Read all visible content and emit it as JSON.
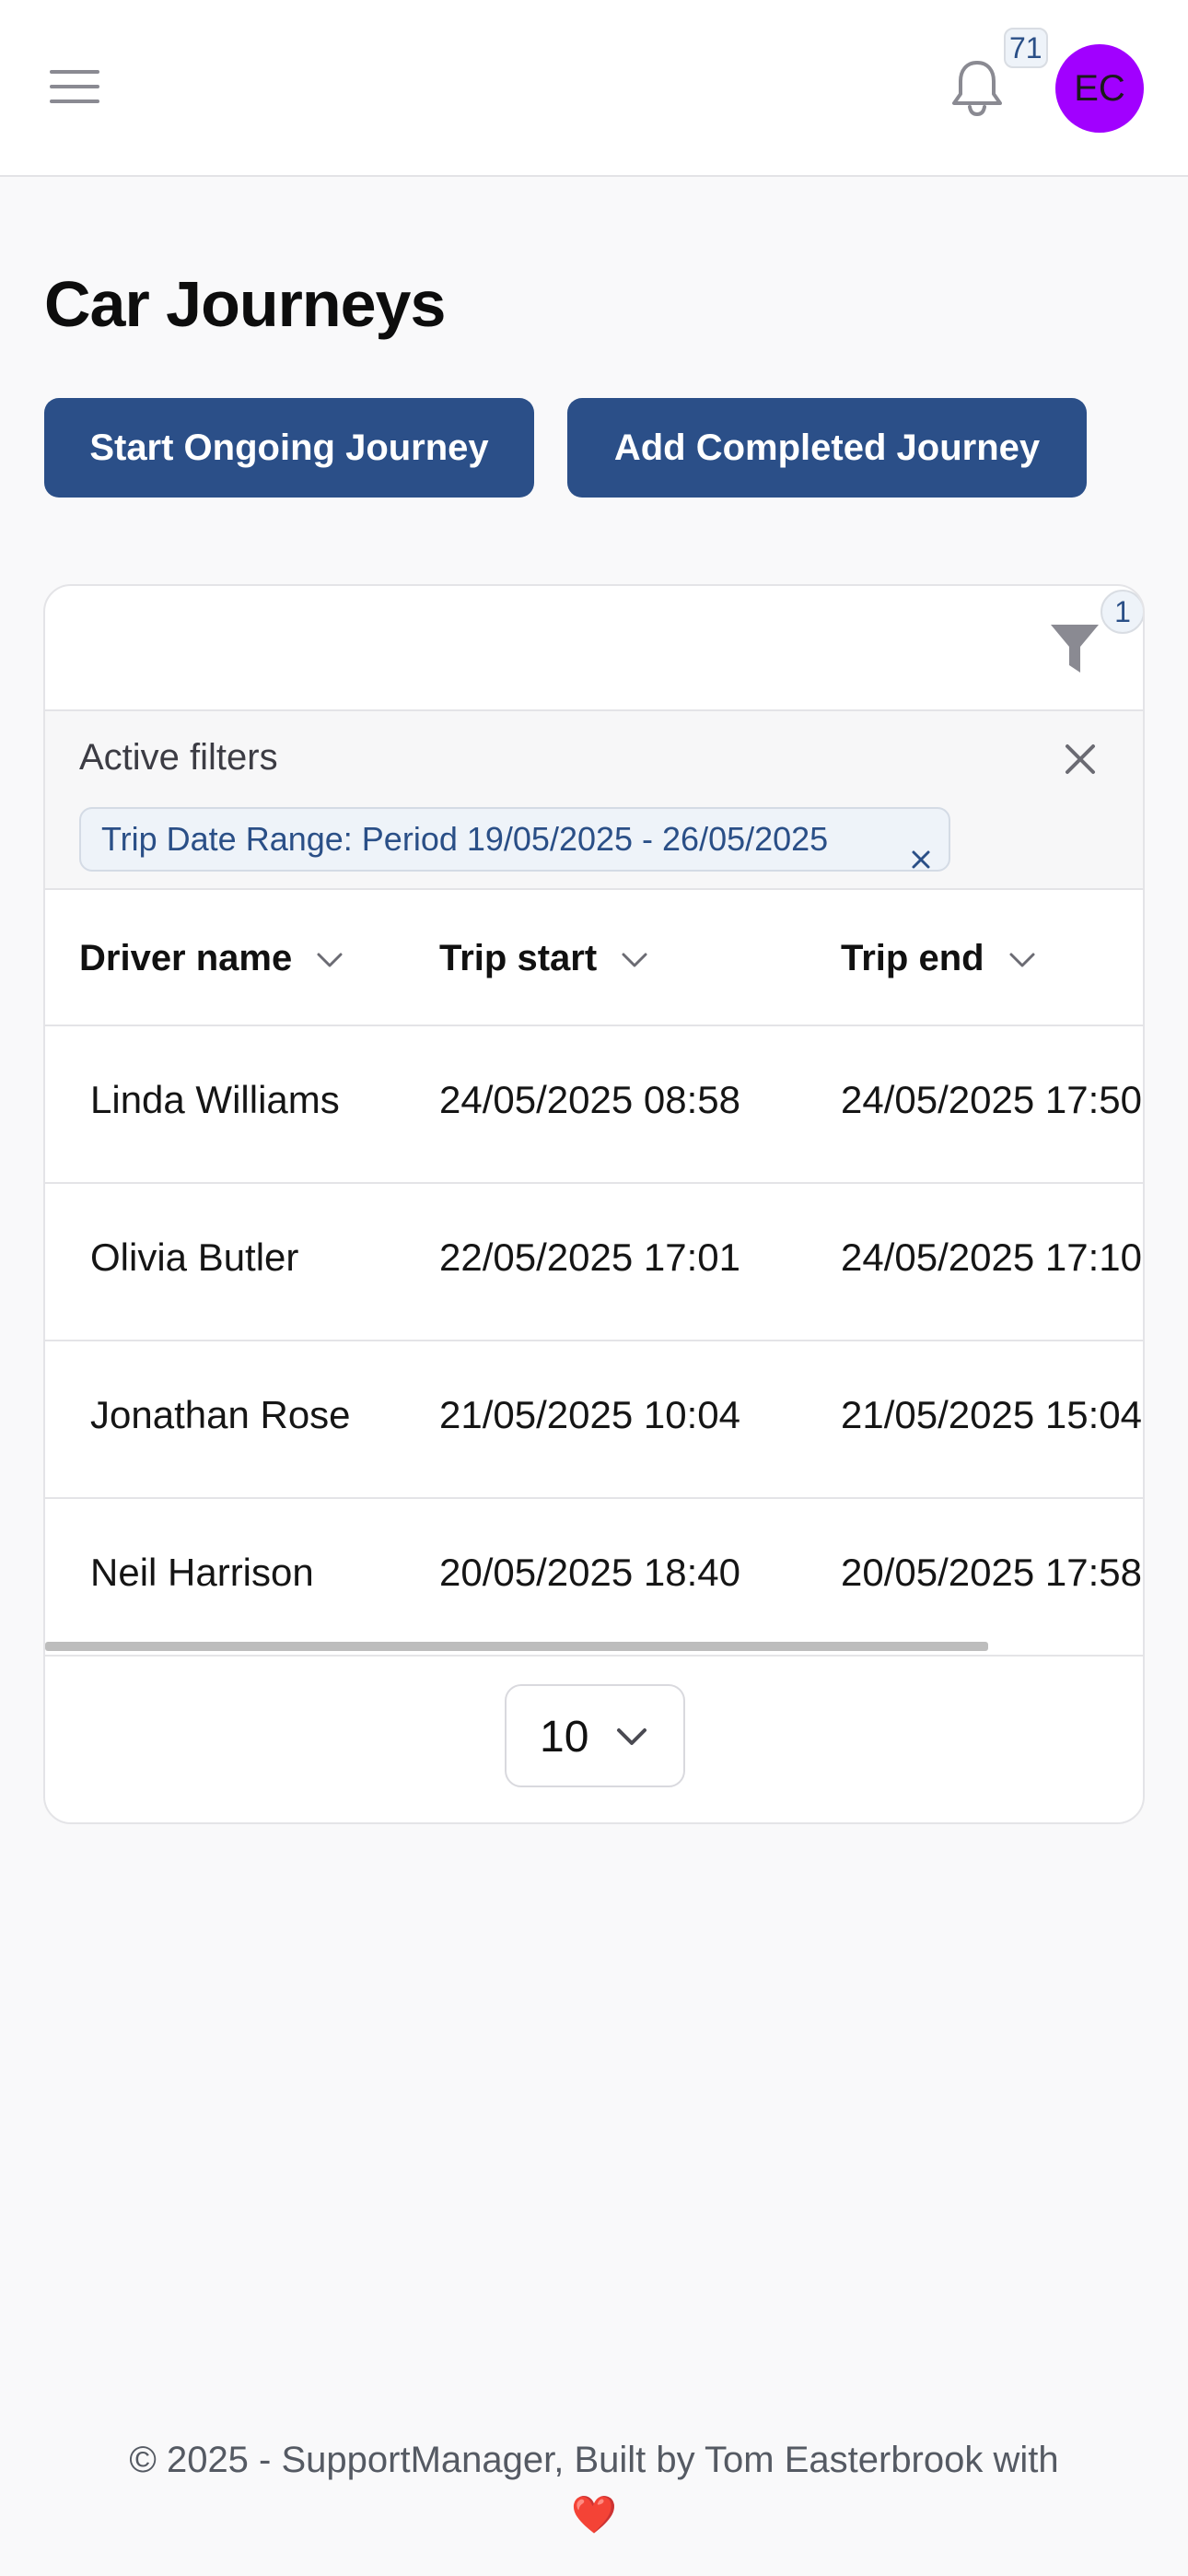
{
  "topbar": {
    "notification_count": "71",
    "avatar_initials": "EC",
    "avatar_color": "#a100ff"
  },
  "page": {
    "title": "Car Journeys"
  },
  "actions": {
    "start_ongoing": "Start Ongoing Journey",
    "add_completed": "Add Completed Journey"
  },
  "filters": {
    "filter_count": "1",
    "active_label": "Active filters",
    "chips": [
      {
        "label": "Trip Date Range: Period 19/05/2025 - 26/05/2025"
      }
    ]
  },
  "table": {
    "columns": [
      "Driver name",
      "Trip start",
      "Trip end"
    ],
    "rows": [
      {
        "driver": "Linda Williams",
        "start": "24/05/2025 08:58",
        "end": "24/05/2025 17:50"
      },
      {
        "driver": "Olivia Butler",
        "start": "22/05/2025 17:01",
        "end": "24/05/2025 17:10"
      },
      {
        "driver": "Jonathan Rose",
        "start": "21/05/2025 10:04",
        "end": "21/05/2025 15:04"
      },
      {
        "driver": "Neil Harrison",
        "start": "20/05/2025 18:40",
        "end": "20/05/2025 17:58"
      }
    ]
  },
  "pagination": {
    "page_size": "10"
  },
  "footer": {
    "text": "© 2025 - SupportManager, Built by Tom Easterbrook with",
    "heart": "❤️"
  },
  "colors": {
    "primary": "#2b4f88",
    "badge_text": "#2a4f87",
    "background": "#f9f9fa"
  },
  "icons": [
    "hamburger-icon",
    "bell-icon",
    "filter-icon",
    "close-icon",
    "chevron-down-icon"
  ]
}
